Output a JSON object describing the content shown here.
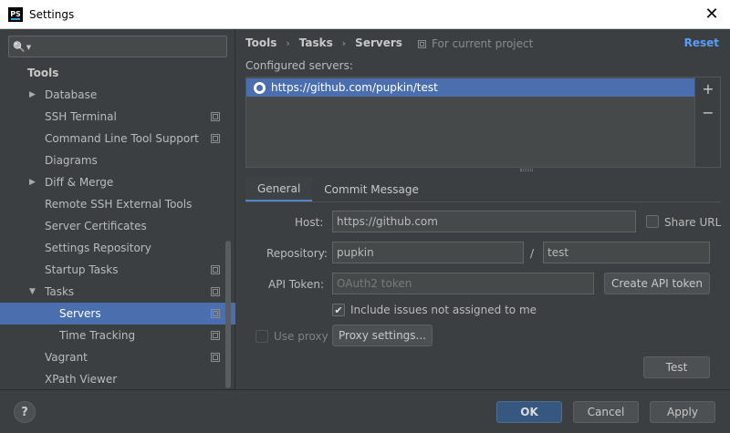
{
  "window": {
    "app_icon": "PS",
    "title": "Settings",
    "close_glyph": "✕"
  },
  "sidebar": {
    "search_glyph": "🔍",
    "items": [
      {
        "label": "Tools",
        "level": 0,
        "bold": true
      },
      {
        "label": "Database",
        "level": 1,
        "arrow": "▶"
      },
      {
        "label": "SSH Terminal",
        "level": 1,
        "project": true
      },
      {
        "label": "Command Line Tool Support",
        "level": 1,
        "project": true
      },
      {
        "label": "Diagrams",
        "level": 1
      },
      {
        "label": "Diff & Merge",
        "level": 1,
        "arrow": "▶"
      },
      {
        "label": "Remote SSH External Tools",
        "level": 1
      },
      {
        "label": "Server Certificates",
        "level": 1
      },
      {
        "label": "Settings Repository",
        "level": 1
      },
      {
        "label": "Startup Tasks",
        "level": 1,
        "project": true
      },
      {
        "label": "Tasks",
        "level": 1,
        "arrow": "▼",
        "project": true
      },
      {
        "label": "Servers",
        "level": 2,
        "project": true,
        "selected": true
      },
      {
        "label": "Time Tracking",
        "level": 2,
        "project": true
      },
      {
        "label": "Vagrant",
        "level": 1,
        "project": true
      },
      {
        "label": "XPath Viewer",
        "level": 1
      }
    ]
  },
  "header": {
    "breadcrumbs": [
      "Tools",
      "Tasks",
      "Servers"
    ],
    "separator": "›",
    "scope": "For current project",
    "reset": "Reset"
  },
  "servers": {
    "label": "Configured servers:",
    "items": [
      "https://github.com/pupkin/test"
    ],
    "add_glyph": "+",
    "remove_glyph": "−"
  },
  "tabs": [
    {
      "label": "General",
      "active": true
    },
    {
      "label": "Commit Message",
      "active": false
    }
  ],
  "form": {
    "host_label": "Host:",
    "host_value": "https://github.com",
    "share_url_label": "Share URL",
    "share_url_checked": false,
    "repository_label": "Repository:",
    "repo_owner": "pupkin",
    "repo_sep": "/",
    "repo_name": "test",
    "api_token_label": "API Token:",
    "api_token_placeholder": "OAuth2 token",
    "create_token_button": "Create API token",
    "include_issues_label": "Include issues not assigned to me",
    "include_issues_checked": true,
    "check_glyph": "✔",
    "use_proxy_label": "Use proxy",
    "use_proxy_checked": false,
    "proxy_settings_button": "Proxy settings...",
    "test_button": "Test"
  },
  "footer": {
    "help": "?",
    "ok": "OK",
    "cancel": "Cancel",
    "apply": "Apply"
  },
  "colors": {
    "background": "#3c3f41",
    "selection": "#4b6eaf",
    "accent_link": "#589df6",
    "primary_button": "#365880"
  }
}
